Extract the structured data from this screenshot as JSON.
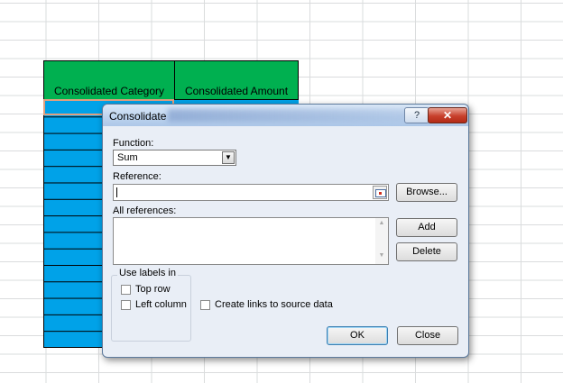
{
  "sheet": {
    "headers": [
      "Consolidated Category",
      "Consolidated Amount"
    ],
    "colors": {
      "header_fill": "#00b050",
      "data_fill": "#00a2e8"
    }
  },
  "dialog": {
    "title": "Consolidate",
    "help_glyph": "?",
    "close_glyph": "✕",
    "function_label": "Function:",
    "function_value": "Sum",
    "reference_label": "Reference:",
    "reference_value": "",
    "browse_button": "Browse...",
    "all_references_label": "All references:",
    "add_button": "Add",
    "delete_button": "Delete",
    "use_labels_in": "Use labels in",
    "top_row": "Top row",
    "left_column": "Left column",
    "create_links": "Create links to source data",
    "ok_button": "OK",
    "close_button": "Close",
    "icons": {
      "dropdown": "chevron-down-icon",
      "ref_collapse": "collapse-dialog-icon",
      "scroll_up": "scroll-up-icon",
      "scroll_down": "scroll-down-icon"
    }
  }
}
